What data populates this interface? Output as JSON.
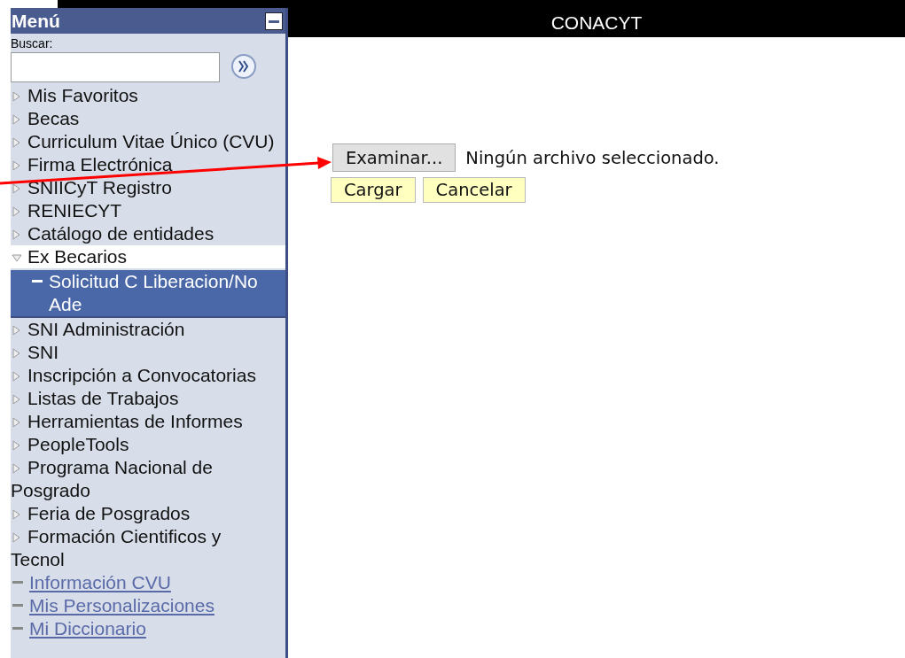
{
  "header": {
    "title": "CONACYT"
  },
  "menu": {
    "title": "Menú",
    "search": {
      "label": "Buscar:"
    },
    "items": [
      {
        "label": "Mis Favoritos",
        "kind": "folder",
        "expanded": false,
        "selected": false
      },
      {
        "label": "Becas",
        "kind": "folder",
        "expanded": false,
        "selected": false
      },
      {
        "label": "Curriculum Vitae Único (CVU)",
        "kind": "folder",
        "expanded": false,
        "selected": false
      },
      {
        "label": "Firma Electrónica",
        "kind": "folder",
        "expanded": false,
        "selected": false
      },
      {
        "label": "SNIICyT Registro",
        "kind": "folder",
        "expanded": false,
        "selected": false
      },
      {
        "label": "RENIECYT",
        "kind": "folder",
        "expanded": false,
        "selected": false
      },
      {
        "label": "Catálogo de entidades",
        "kind": "folder",
        "expanded": false,
        "selected": false
      },
      {
        "label": "Ex Becarios",
        "kind": "folder",
        "expanded": true,
        "selected": false,
        "children": [
          {
            "label": "Solicitud C Liberacion/No Ade",
            "kind": "page",
            "selected": true
          }
        ]
      },
      {
        "label": "SNI Administración",
        "kind": "folder",
        "expanded": false,
        "selected": false
      },
      {
        "label": "SNI",
        "kind": "folder",
        "expanded": false,
        "selected": false
      },
      {
        "label": "Inscripción a Convocatorias",
        "kind": "folder",
        "expanded": false,
        "selected": false
      },
      {
        "label": "Listas de Trabajos",
        "kind": "folder",
        "expanded": false,
        "selected": false
      },
      {
        "label": "Herramientas de Informes",
        "kind": "folder",
        "expanded": false,
        "selected": false
      },
      {
        "label": "PeopleTools",
        "kind": "folder",
        "expanded": false,
        "selected": false
      },
      {
        "label": "Programa Nacional de Posgrado",
        "kind": "folder",
        "expanded": false,
        "selected": false
      },
      {
        "label": "Feria de Posgrados",
        "kind": "folder",
        "expanded": false,
        "selected": false
      },
      {
        "label": "Formación Cientificos y Tecnol",
        "kind": "folder",
        "expanded": false,
        "selected": false
      },
      {
        "label": "Información CVU",
        "kind": "link",
        "selected": false
      },
      {
        "label": "Mis Personalizaciones",
        "kind": "link",
        "selected": false
      },
      {
        "label": "Mi Diccionario",
        "kind": "link",
        "selected": false
      }
    ]
  },
  "upload": {
    "browse_button": "Examinar...",
    "file_status": "Ningún archivo seleccionado.",
    "buttons": [
      "Cargar",
      "Cancelar"
    ]
  }
}
